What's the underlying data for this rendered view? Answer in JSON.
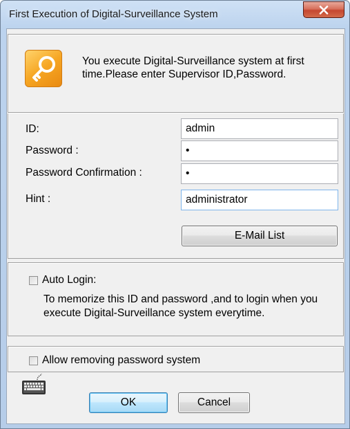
{
  "window": {
    "title": "First Execution of Digital-Surveillance System",
    "close_glyph": "X"
  },
  "intro": {
    "icon": "key-icon",
    "message": "You execute Digital-Surveillance system at first time.Please enter Supervisor ID,Password."
  },
  "form": {
    "id_label": "ID:",
    "id_value": "admin",
    "password_label": "Password :",
    "password_value": "•",
    "confirm_label": "Password Confirmation :",
    "confirm_value": "•",
    "hint_label": "Hint :",
    "hint_value": "administrator",
    "email_button": "E-Mail List"
  },
  "auto_login": {
    "label": "Auto Login:",
    "checked": false,
    "description": "To memorize this ID and password ,and to login when you execute Digital-Surveillance system everytime."
  },
  "remove_password": {
    "label": "Allow removing password system",
    "checked": false
  },
  "footer": {
    "keyboard_icon": "keyboard-icon",
    "ok": "OK",
    "cancel": "Cancel"
  }
}
